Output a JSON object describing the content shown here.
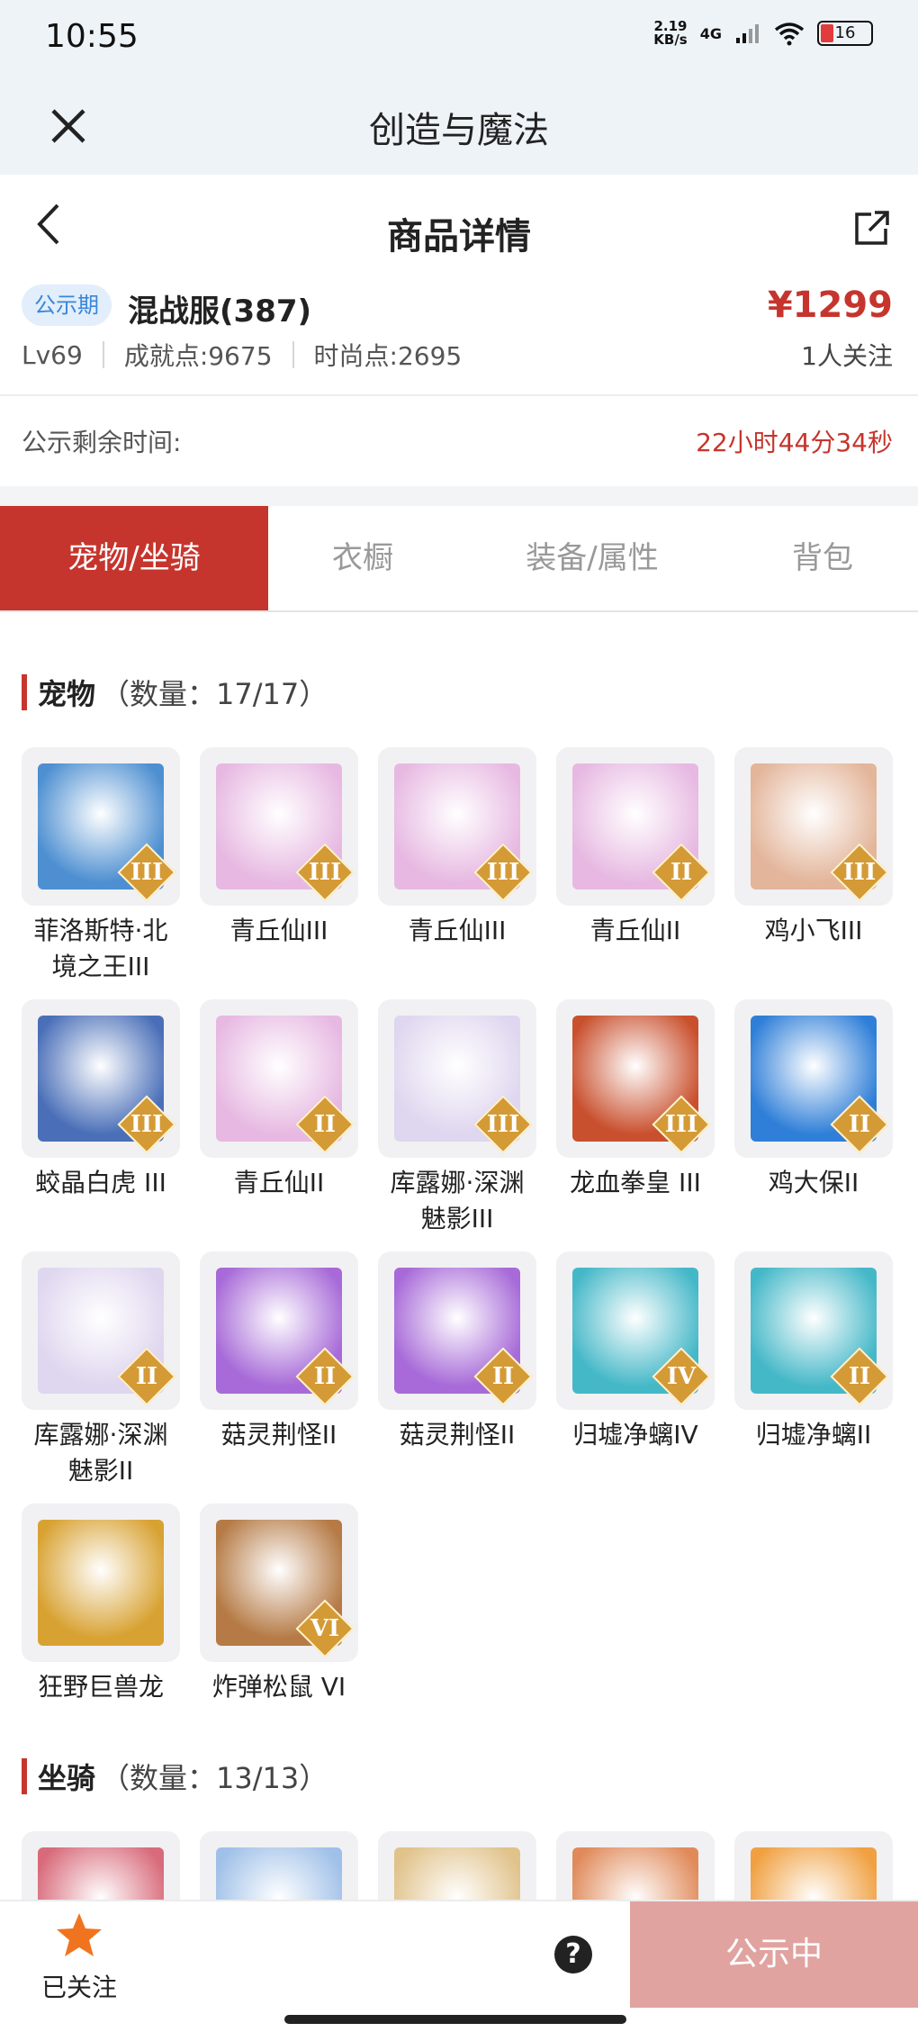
{
  "status_bar": {
    "time": "10:55",
    "speed": "2.19",
    "speed_unit": "KB/s",
    "network": "4G",
    "battery": "16"
  },
  "app_bar": {
    "title": "创造与魔法"
  },
  "nav": {
    "title": "商品详情"
  },
  "item": {
    "badge": "公示期",
    "server": "混战服(387)",
    "price": "¥1299",
    "level": "Lv69",
    "achievement": "成就点:9675",
    "fashion": "时尚点:2695",
    "followers": "1人关注"
  },
  "countdown": {
    "label": "公示剩余时间:",
    "value": "22小时44分34秒"
  },
  "tabs": [
    "宠物/坐骑",
    "衣橱",
    "装备/属性",
    "背包"
  ],
  "pets_section": {
    "title": "宠物",
    "count": "（数量：17/17）"
  },
  "pets": [
    {
      "name": "菲洛斯特·北\n境之王III",
      "tier": "III",
      "color": "#4d8fd1"
    },
    {
      "name": "青丘仙III",
      "tier": "III",
      "color": "#e7b9e2"
    },
    {
      "name": "青丘仙III",
      "tier": "III",
      "color": "#e7b9e2"
    },
    {
      "name": "青丘仙II",
      "tier": "II",
      "color": "#e7b9e2"
    },
    {
      "name": "鸡小飞III",
      "tier": "III",
      "color": "#e3b59a"
    },
    {
      "name": "蛟晶白虎 III",
      "tier": "III",
      "color": "#4a6fb8"
    },
    {
      "name": "青丘仙II",
      "tier": "II",
      "color": "#e7b9e2"
    },
    {
      "name": "库露娜·深渊\n魅影III",
      "tier": "III",
      "color": "#dfd6ef"
    },
    {
      "name": "龙血拳皇 III",
      "tier": "III",
      "color": "#c9502e"
    },
    {
      "name": "鸡大保II",
      "tier": "II",
      "color": "#2f7fd8"
    },
    {
      "name": "库露娜·深渊\n魅影II",
      "tier": "II",
      "color": "#dfd6ef"
    },
    {
      "name": "菇灵荆怪II",
      "tier": "II",
      "color": "#a76ad8"
    },
    {
      "name": "菇灵荆怪II",
      "tier": "II",
      "color": "#a76ad8"
    },
    {
      "name": "归墟净螭IV",
      "tier": "IV",
      "color": "#45b8c8"
    },
    {
      "name": "归墟净螭II",
      "tier": "II",
      "color": "#45b8c8"
    },
    {
      "name": "狂野巨兽龙",
      "tier": "",
      "color": "#d8a232"
    },
    {
      "name": "炸弹松鼠 VI",
      "tier": "VI",
      "color": "#b57a45"
    }
  ],
  "mounts_section": {
    "title": "坐骑",
    "count": "（数量：13/13）"
  },
  "mounts": [
    {
      "color": "#d86a7a"
    },
    {
      "color": "#9fc0e8"
    },
    {
      "color": "#e0c28a"
    },
    {
      "color": "#e08a5a"
    },
    {
      "color": "#f0a040"
    }
  ],
  "bottom": {
    "follow_label": "已关注",
    "help": "?",
    "action": "公示中"
  },
  "colors": {
    "accent": "#c6352d",
    "badge_bg": "#e2eefb",
    "badge_text": "#3a86d8"
  }
}
